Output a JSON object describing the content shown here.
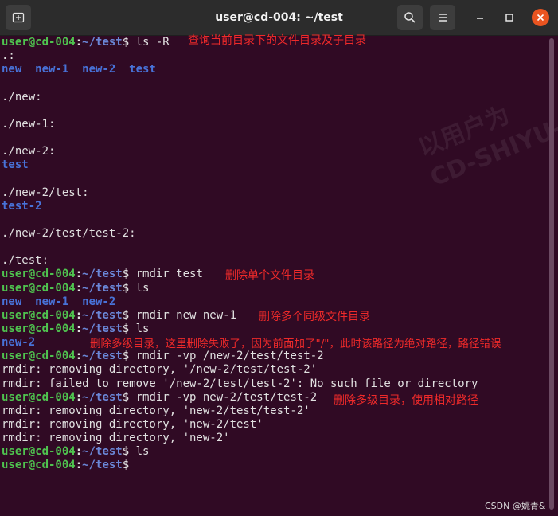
{
  "window": {
    "title": "user@cd-004: ~/test"
  },
  "prompt": {
    "user_host": "user@cd-004",
    "path": "~/test"
  },
  "terminal": {
    "lines": [
      {
        "type": "prompt",
        "cmd": "ls -R"
      },
      {
        "type": "text",
        "text": ".:"
      },
      {
        "type": "dirs",
        "text": "new  new-1  new-2  test"
      },
      {
        "type": "text",
        "text": ""
      },
      {
        "type": "text",
        "text": "./new:"
      },
      {
        "type": "text",
        "text": ""
      },
      {
        "type": "text",
        "text": "./new-1:"
      },
      {
        "type": "text",
        "text": ""
      },
      {
        "type": "text",
        "text": "./new-2:"
      },
      {
        "type": "dirs",
        "text": "test"
      },
      {
        "type": "text",
        "text": ""
      },
      {
        "type": "text",
        "text": "./new-2/test:"
      },
      {
        "type": "dirs",
        "text": "test-2"
      },
      {
        "type": "text",
        "text": ""
      },
      {
        "type": "text",
        "text": "./new-2/test/test-2:"
      },
      {
        "type": "text",
        "text": ""
      },
      {
        "type": "text",
        "text": "./test:"
      },
      {
        "type": "prompt",
        "cmd": "rmdir test"
      },
      {
        "type": "prompt",
        "cmd": "ls"
      },
      {
        "type": "dirs",
        "text": "new  new-1  new-2"
      },
      {
        "type": "prompt",
        "cmd": "rmdir new new-1"
      },
      {
        "type": "prompt",
        "cmd": "ls"
      },
      {
        "type": "dirs",
        "text": "new-2"
      },
      {
        "type": "prompt",
        "cmd": "rmdir -vp /new-2/test/test-2"
      },
      {
        "type": "text",
        "text": "rmdir: removing directory, '/new-2/test/test-2'"
      },
      {
        "type": "text",
        "text": "rmdir: failed to remove '/new-2/test/test-2': No such file or directory"
      },
      {
        "type": "prompt",
        "cmd": "rmdir -vp new-2/test/test-2"
      },
      {
        "type": "text",
        "text": "rmdir: removing directory, 'new-2/test/test-2'"
      },
      {
        "type": "text",
        "text": "rmdir: removing directory, 'new-2/test'"
      },
      {
        "type": "text",
        "text": "rmdir: removing directory, 'new-2'"
      },
      {
        "type": "prompt",
        "cmd": "ls"
      },
      {
        "type": "prompt",
        "cmd": ""
      }
    ]
  },
  "annotations": {
    "ls_r": "查询当前目录下的文件目录及子目录",
    "rmdir_single": "删除单个文件目录",
    "rmdir_multi": "删除多个同级文件目录",
    "rmdir_abs_fail": "删除多级目录，这里删除失败了，因为前面加了\"/\"，此时该路径为绝对路径，路径错误",
    "rmdir_rel": "删除多级目录，使用相对路径"
  },
  "watermark": {
    "line1": "以用户为",
    "line2": "CD-SHIYU-I"
  },
  "credit": "CSDN @姚青&",
  "colors": {
    "background": "#300a24",
    "prompt_user": "#4fc34f",
    "prompt_path": "#6a86d6",
    "directory": "#4872d8",
    "annotation": "#ee2a2a",
    "close_button": "#e95420"
  }
}
